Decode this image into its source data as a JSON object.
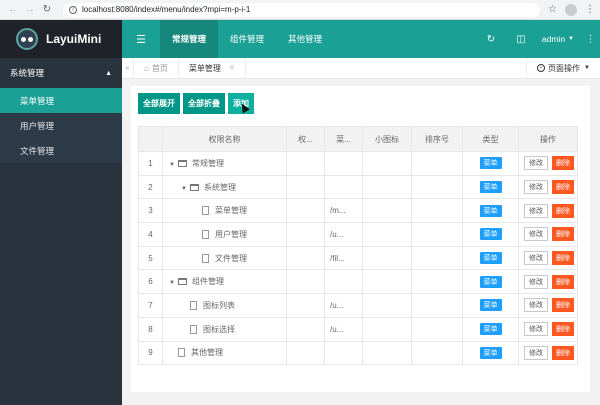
{
  "browser": {
    "url": "localhost:8080/index#/menu/index?mpi=m-p-i-1"
  },
  "app": {
    "name": "LayuiMini"
  },
  "header": {
    "nav": [
      "常规管理",
      "组件管理",
      "其他管理"
    ],
    "active_nav": 0,
    "user": "admin"
  },
  "sidebar": {
    "group": "系统管理",
    "items": [
      "菜单管理",
      "用户管理",
      "文件管理"
    ],
    "active_item": 0
  },
  "tabs": {
    "home": "首页",
    "current": "菜单管理",
    "page_ops": "页面操作"
  },
  "toolbar": {
    "expand_all": "全部展开",
    "collapse_all": "全部折叠",
    "add": "添加"
  },
  "table": {
    "headers": [
      "",
      "权限名称",
      "权...",
      "菜...",
      "小图标",
      "排序号",
      "类型",
      "操作"
    ],
    "rows": [
      {
        "num": "1",
        "name": "常规管理",
        "level": 0,
        "kind": "folder",
        "expanded": true,
        "perm": "",
        "href": "",
        "type": "菜单"
      },
      {
        "num": "2",
        "name": "系统管理",
        "level": 1,
        "kind": "folder",
        "expanded": true,
        "perm": "",
        "href": "",
        "type": "菜单"
      },
      {
        "num": "3",
        "name": "菜单管理",
        "level": 2,
        "kind": "file",
        "perm": "",
        "href": "/m...",
        "type": "菜单"
      },
      {
        "num": "4",
        "name": "用户管理",
        "level": 2,
        "kind": "file",
        "perm": "",
        "href": "/u...",
        "type": "菜单"
      },
      {
        "num": "5",
        "name": "文件管理",
        "level": 2,
        "kind": "file",
        "perm": "",
        "href": "/fil...",
        "type": "菜单"
      },
      {
        "num": "6",
        "name": "组件管理",
        "level": 0,
        "kind": "folder",
        "expanded": true,
        "perm": "",
        "href": "",
        "type": "菜单"
      },
      {
        "num": "7",
        "name": "图标列表",
        "level": 1,
        "kind": "file",
        "perm": "",
        "href": "/u...",
        "type": "菜单"
      },
      {
        "num": "8",
        "name": "图标选择",
        "level": 1,
        "kind": "file",
        "perm": "",
        "href": "/u...",
        "type": "菜单"
      },
      {
        "num": "9",
        "name": "其他管理",
        "level": 0,
        "kind": "file",
        "perm": "",
        "href": "",
        "type": "菜单"
      }
    ],
    "edit_label": "修改",
    "delete_label": "删除"
  },
  "colors": {
    "brand": "#1aa094",
    "sidebar": "#28333e",
    "badge": "#1e9fff",
    "danger": "#ff5722"
  }
}
